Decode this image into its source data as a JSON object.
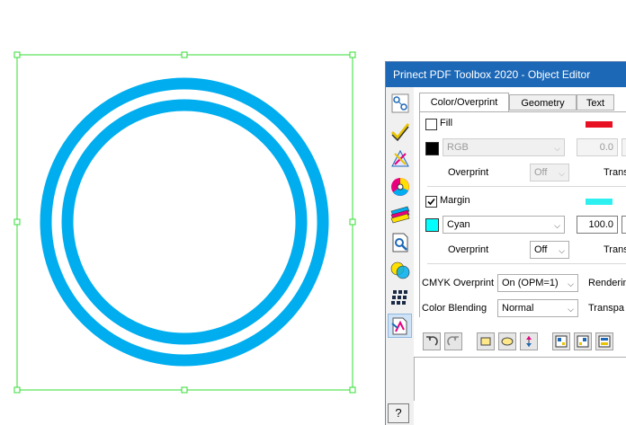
{
  "window": {
    "title": "Prinect PDF Toolbox 2020 - Object Editor"
  },
  "tools": [
    {
      "icon": "structure-tool-icon"
    },
    {
      "icon": "checkmark-tool-icon"
    },
    {
      "icon": "transform-tool-icon"
    },
    {
      "icon": "color-wheel-tool-icon"
    },
    {
      "icon": "color-swatches-tool-icon"
    },
    {
      "icon": "document-search-tool-icon"
    },
    {
      "icon": "overprint-circles-tool-icon"
    },
    {
      "icon": "grid-tool-icon"
    },
    {
      "icon": "object-editor-tool-icon"
    }
  ],
  "tabs": [
    "Color/Overprint",
    "Geometry",
    "Text"
  ],
  "fill": {
    "label": "Fill",
    "checked": false,
    "indicator_color": "#e81123",
    "swatch_color": "#000000",
    "colorspace": "RGB",
    "value": "0.0",
    "overprint_label": "Overprint",
    "overprint_value": "Off",
    "trans_label": "Trans"
  },
  "margin": {
    "label": "Margin",
    "checked": true,
    "indicator_color": "#2ff0f0",
    "swatch_color": "#00ffff",
    "colorspace": "Cyan",
    "value": "100.0",
    "overprint_label": "Overprint",
    "overprint_value": "Off",
    "trans_label": "Trans"
  },
  "cmyk_overprint": {
    "label": "CMYK Overprint",
    "value": "On (OPM=1)",
    "rendering_label": "Renderin"
  },
  "color_blending": {
    "label": "Color Blending",
    "value": "Normal",
    "transparency_label": "Transpa"
  },
  "help": {
    "label": "?"
  },
  "canvas": {
    "ring_color": "#00aeef",
    "selection_color": "#33dd33"
  }
}
